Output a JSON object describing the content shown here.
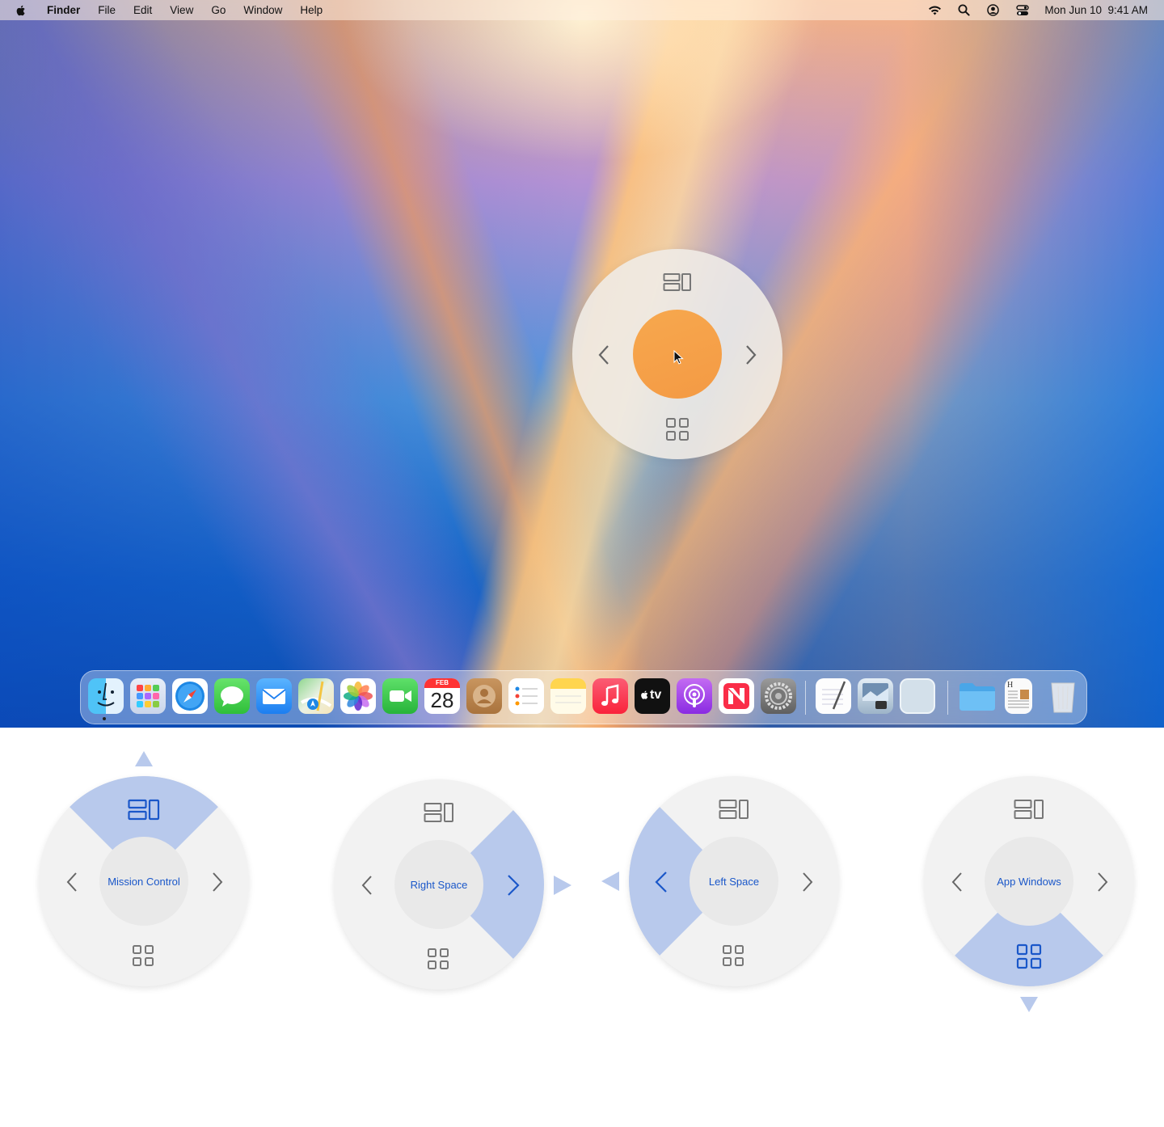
{
  "menubar": {
    "apple": "apple-logo-icon",
    "app_name": "Finder",
    "menus": [
      "File",
      "Edit",
      "View",
      "Go",
      "Window",
      "Help"
    ],
    "status_icons": [
      "wifi-icon",
      "search-icon",
      "user-icon",
      "control-center-icon"
    ],
    "clock": "Mon Jun 10  9:41 AM"
  },
  "hud": {
    "top": "mission-control-icon",
    "left": "chevron-left-icon",
    "right": "chevron-right-icon",
    "bottom": "app-windows-icon"
  },
  "dock": {
    "apps": [
      "Finder",
      "Launchpad",
      "Safari",
      "Messages",
      "Mail",
      "Maps",
      "Photos",
      "FaceTime",
      "Calendar",
      "Contacts",
      "Reminders",
      "Notes",
      "Music",
      "TV",
      "Podcasts",
      "News",
      "System Settings",
      "TextEdit",
      "Preview",
      "Blank",
      "Folder",
      "Document",
      "Trash"
    ],
    "calendar_month": "FEB",
    "calendar_day": "28",
    "tv_label": "tv"
  },
  "wheels": [
    {
      "label": "Mission Control",
      "highlight": "top"
    },
    {
      "label": "Right Space",
      "highlight": "right"
    },
    {
      "label": "Left Space",
      "highlight": "left"
    },
    {
      "label": "App Windows",
      "highlight": "bottom"
    }
  ],
  "colors": {
    "accent": "#1a57c9",
    "highlight": "#b8c9ec",
    "wheel_bg": "#f2f2f2"
  }
}
